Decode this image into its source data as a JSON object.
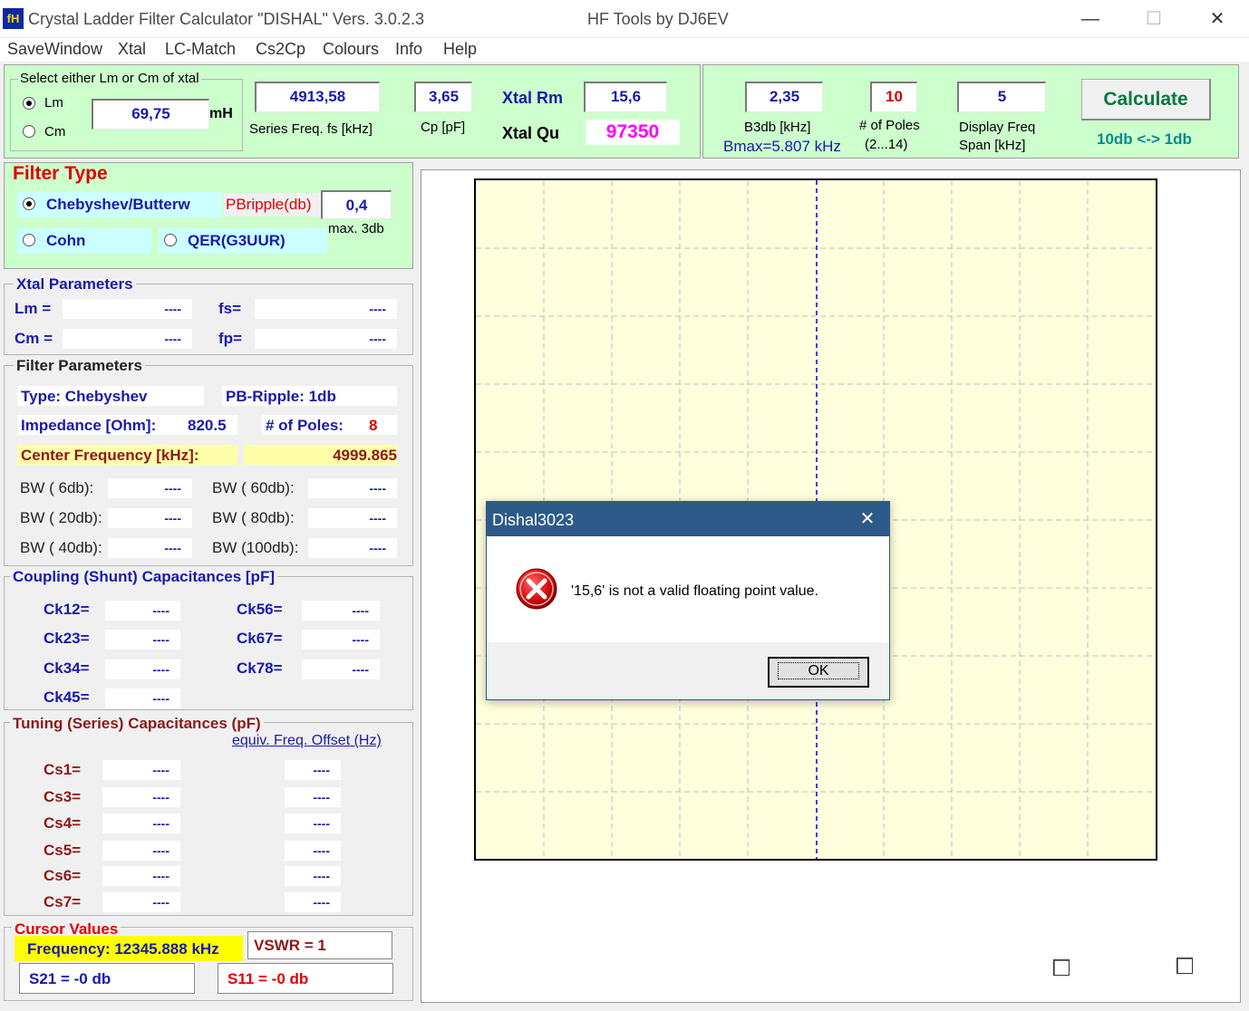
{
  "window": {
    "title": "Crystal Ladder Filter Calculator  \"DISHAL\"  Vers. 3.0.2.3",
    "title_right": "HF Tools by DJ6EV",
    "icon_text": "fH",
    "min_glyph": "—",
    "max_glyph": "☐",
    "close_glyph": "✕"
  },
  "menu": [
    "SaveWindow",
    "Xtal",
    "LC-Match",
    "Cs2Cp",
    "Colours",
    "Info",
    "Help"
  ],
  "xtal_select": {
    "group_title": "Select either Lm or Cm of xtal",
    "lm_label": "Lm",
    "cm_label": "Cm",
    "value": "69,75",
    "unit": "mH"
  },
  "series_freq": {
    "value": "4913,58",
    "label": "Series Freq. fs [kHz]"
  },
  "cp": {
    "value": "3,65",
    "label": "Cp [pF]"
  },
  "xtal_rm": {
    "label": "Xtal Rm",
    "value": "15,6"
  },
  "xtal_qu": {
    "label": "Xtal Qu",
    "value": "97350"
  },
  "b3db": {
    "value": "2,35",
    "label": "B3db [kHz]",
    "bmax": "Bmax=5.807 kHz"
  },
  "poles": {
    "value": "10",
    "label": "# of Poles",
    "range": "(2...14)"
  },
  "span": {
    "value": "5",
    "label1": "Display Freq",
    "label2": "Span [kHz]"
  },
  "calculate": {
    "label": "Calculate",
    "toggle": "10db <-> 1db"
  },
  "filter_type": {
    "title": "Filter Type",
    "cheby": "Chebyshev/Butterw",
    "ripple_label": "PBripple(db)",
    "ripple_value": "0,4",
    "ripple_max": "max. 3db",
    "cohn": "Cohn",
    "qer": "QER(G3UUR)"
  },
  "xtal_params": {
    "title": "Xtal Parameters",
    "lm": "Lm =",
    "fs": "fs=",
    "cm": "Cm =",
    "fp": "fp=",
    "empty": "----"
  },
  "filter_params": {
    "title": "Filter Parameters",
    "type": "Type:  Chebyshev",
    "ripple": "PB-Ripple: 1db",
    "impedance_label": "Impedance [Ohm]:",
    "impedance_value": "820.5",
    "poles_label": "# of Poles:",
    "poles_value": "8",
    "center_label": "Center Frequency [kHz]:",
    "center_value": "4999.865",
    "bw6": "BW (  6db):",
    "bw60": "BW ( 60db):",
    "bw20": "BW ( 20db):",
    "bw80": "BW ( 80db):",
    "bw40": "BW ( 40db):",
    "bw100": "BW (100db):"
  },
  "coupling": {
    "title": "Coupling (Shunt) Capacitances [pF]",
    "ck12": "Ck12=",
    "ck23": "Ck23=",
    "ck34": "Ck34=",
    "ck45": "Ck45=",
    "ck56": "Ck56=",
    "ck67": "Ck67=",
    "ck78": "Ck78="
  },
  "tuning": {
    "title": "Tuning (Series) Capacitances (pF)",
    "offset_link": "equiv. Freq. Offset (Hz)",
    "cs1": "Cs1=",
    "cs3": "Cs3=",
    "cs4": "Cs4=",
    "cs5": "Cs5=",
    "cs6": "Cs6=",
    "cs7": "Cs7="
  },
  "cursor": {
    "title": "Cursor Values",
    "frequency": "Frequency: 12345.888 kHz",
    "vswr": "VSWR = 1",
    "s21": "S21 = -0 db",
    "s11": "S11 = -0 db"
  },
  "dialog": {
    "title": "Dishal3023",
    "message": "'15,6' is not a valid floating point value.",
    "ok": "OK",
    "close_glyph": "✕"
  },
  "colors": {
    "panel_green": "#ccffcc",
    "label_blue": "#1a1aaa",
    "alert_red": "#e00000",
    "magenta": "#ff00ff",
    "chart_bg": "#ffffdd",
    "dialog_title": "#2d5a88"
  }
}
